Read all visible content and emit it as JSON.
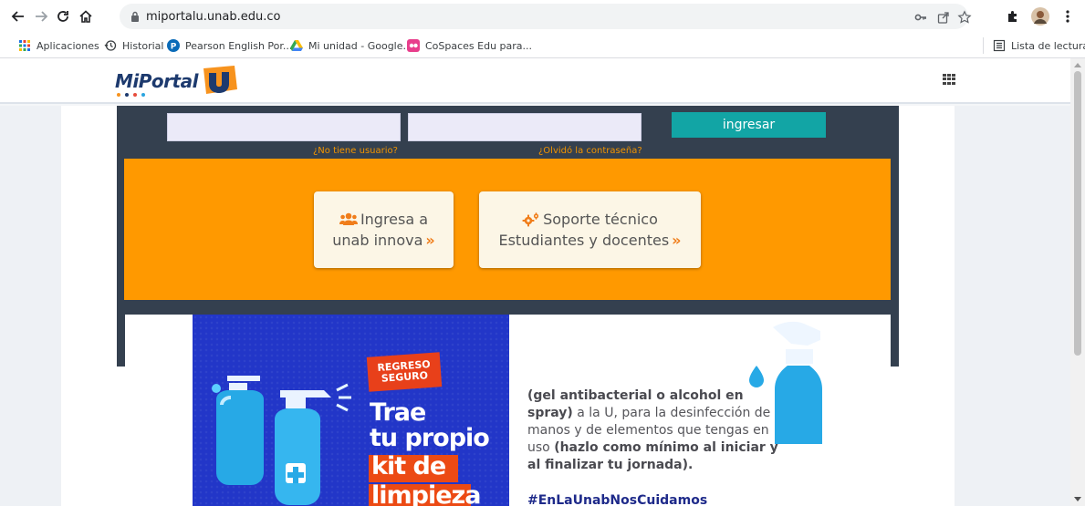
{
  "browser": {
    "url": "miportalu.unab.edu.co",
    "bookmarks": [
      {
        "label": "Aplicaciones",
        "icon": "apps-grid-icon"
      },
      {
        "label": "Historial",
        "icon": "history-icon"
      },
      {
        "label": "Pearson English Por...",
        "icon": "pearson-icon"
      },
      {
        "label": "Mi unidad - Google...",
        "icon": "google-drive-icon"
      },
      {
        "label": "CoSpaces Edu para...",
        "icon": "cospaces-icon"
      }
    ],
    "reading_list": "Lista de lectura"
  },
  "site": {
    "logo_text": "MiPortal",
    "logo_colors": [
      "#f7931e",
      "#1d3a6e",
      "#e74c3c",
      "#7ab648"
    ]
  },
  "login": {
    "submit_label": "ingresar",
    "no_user_link": "¿No tiene usuario?",
    "forgot_link": "¿Olvidó la contraseña?"
  },
  "cards": [
    {
      "line1": "Ingresa a",
      "line2": "unab innova",
      "icon": "users-icon"
    },
    {
      "line1": "Soporte técnico",
      "line2": "Estudiantes y docentes",
      "icon": "gears-icon"
    }
  ],
  "banner": {
    "badge_line1": "REGRESO",
    "badge_line2": "SEGURO",
    "headline1": "Trae",
    "headline2": "tu propio",
    "headline3": "kit de",
    "headline4": "limpieza",
    "body_bold1": "(gel antibacterial o alcohol en spray)",
    "body_regular": " a la U, para la desinfección de manos y de elementos que tengas en uso ",
    "body_bold2": "(hazlo como mínimo al iniciar y al finalizar tu jornada).",
    "hashtag": "#EnLaUnabNosCuidamos"
  },
  "colors": {
    "panel": "#34404f",
    "orange": "#ff9900",
    "teal": "#12a5a5",
    "banner_blue": "#2236c8"
  }
}
